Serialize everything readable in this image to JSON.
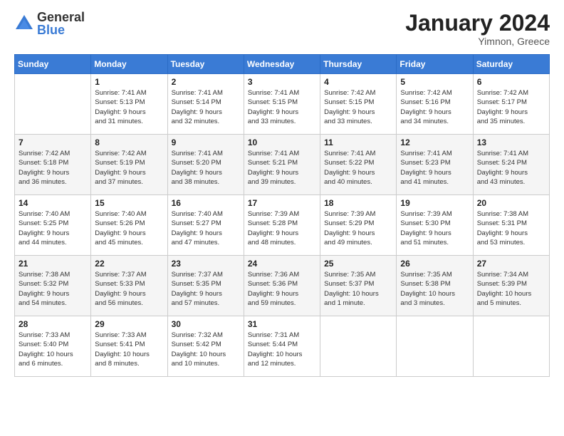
{
  "header": {
    "logo_general": "General",
    "logo_blue": "Blue",
    "month_title": "January 2024",
    "location": "Yimnon, Greece"
  },
  "days_of_week": [
    "Sunday",
    "Monday",
    "Tuesday",
    "Wednesday",
    "Thursday",
    "Friday",
    "Saturday"
  ],
  "weeks": [
    [
      {
        "day": "",
        "info": ""
      },
      {
        "day": "1",
        "info": "Sunrise: 7:41 AM\nSunset: 5:13 PM\nDaylight: 9 hours\nand 31 minutes."
      },
      {
        "day": "2",
        "info": "Sunrise: 7:41 AM\nSunset: 5:14 PM\nDaylight: 9 hours\nand 32 minutes."
      },
      {
        "day": "3",
        "info": "Sunrise: 7:41 AM\nSunset: 5:15 PM\nDaylight: 9 hours\nand 33 minutes."
      },
      {
        "day": "4",
        "info": "Sunrise: 7:42 AM\nSunset: 5:15 PM\nDaylight: 9 hours\nand 33 minutes."
      },
      {
        "day": "5",
        "info": "Sunrise: 7:42 AM\nSunset: 5:16 PM\nDaylight: 9 hours\nand 34 minutes."
      },
      {
        "day": "6",
        "info": "Sunrise: 7:42 AM\nSunset: 5:17 PM\nDaylight: 9 hours\nand 35 minutes."
      }
    ],
    [
      {
        "day": "7",
        "info": "Sunrise: 7:42 AM\nSunset: 5:18 PM\nDaylight: 9 hours\nand 36 minutes."
      },
      {
        "day": "8",
        "info": "Sunrise: 7:42 AM\nSunset: 5:19 PM\nDaylight: 9 hours\nand 37 minutes."
      },
      {
        "day": "9",
        "info": "Sunrise: 7:41 AM\nSunset: 5:20 PM\nDaylight: 9 hours\nand 38 minutes."
      },
      {
        "day": "10",
        "info": "Sunrise: 7:41 AM\nSunset: 5:21 PM\nDaylight: 9 hours\nand 39 minutes."
      },
      {
        "day": "11",
        "info": "Sunrise: 7:41 AM\nSunset: 5:22 PM\nDaylight: 9 hours\nand 40 minutes."
      },
      {
        "day": "12",
        "info": "Sunrise: 7:41 AM\nSunset: 5:23 PM\nDaylight: 9 hours\nand 41 minutes."
      },
      {
        "day": "13",
        "info": "Sunrise: 7:41 AM\nSunset: 5:24 PM\nDaylight: 9 hours\nand 43 minutes."
      }
    ],
    [
      {
        "day": "14",
        "info": "Sunrise: 7:40 AM\nSunset: 5:25 PM\nDaylight: 9 hours\nand 44 minutes."
      },
      {
        "day": "15",
        "info": "Sunrise: 7:40 AM\nSunset: 5:26 PM\nDaylight: 9 hours\nand 45 minutes."
      },
      {
        "day": "16",
        "info": "Sunrise: 7:40 AM\nSunset: 5:27 PM\nDaylight: 9 hours\nand 47 minutes."
      },
      {
        "day": "17",
        "info": "Sunrise: 7:39 AM\nSunset: 5:28 PM\nDaylight: 9 hours\nand 48 minutes."
      },
      {
        "day": "18",
        "info": "Sunrise: 7:39 AM\nSunset: 5:29 PM\nDaylight: 9 hours\nand 49 minutes."
      },
      {
        "day": "19",
        "info": "Sunrise: 7:39 AM\nSunset: 5:30 PM\nDaylight: 9 hours\nand 51 minutes."
      },
      {
        "day": "20",
        "info": "Sunrise: 7:38 AM\nSunset: 5:31 PM\nDaylight: 9 hours\nand 53 minutes."
      }
    ],
    [
      {
        "day": "21",
        "info": "Sunrise: 7:38 AM\nSunset: 5:32 PM\nDaylight: 9 hours\nand 54 minutes."
      },
      {
        "day": "22",
        "info": "Sunrise: 7:37 AM\nSunset: 5:33 PM\nDaylight: 9 hours\nand 56 minutes."
      },
      {
        "day": "23",
        "info": "Sunrise: 7:37 AM\nSunset: 5:35 PM\nDaylight: 9 hours\nand 57 minutes."
      },
      {
        "day": "24",
        "info": "Sunrise: 7:36 AM\nSunset: 5:36 PM\nDaylight: 9 hours\nand 59 minutes."
      },
      {
        "day": "25",
        "info": "Sunrise: 7:35 AM\nSunset: 5:37 PM\nDaylight: 10 hours\nand 1 minute."
      },
      {
        "day": "26",
        "info": "Sunrise: 7:35 AM\nSunset: 5:38 PM\nDaylight: 10 hours\nand 3 minutes."
      },
      {
        "day": "27",
        "info": "Sunrise: 7:34 AM\nSunset: 5:39 PM\nDaylight: 10 hours\nand 5 minutes."
      }
    ],
    [
      {
        "day": "28",
        "info": "Sunrise: 7:33 AM\nSunset: 5:40 PM\nDaylight: 10 hours\nand 6 minutes."
      },
      {
        "day": "29",
        "info": "Sunrise: 7:33 AM\nSunset: 5:41 PM\nDaylight: 10 hours\nand 8 minutes."
      },
      {
        "day": "30",
        "info": "Sunrise: 7:32 AM\nSunset: 5:42 PM\nDaylight: 10 hours\nand 10 minutes."
      },
      {
        "day": "31",
        "info": "Sunrise: 7:31 AM\nSunset: 5:44 PM\nDaylight: 10 hours\nand 12 minutes."
      },
      {
        "day": "",
        "info": ""
      },
      {
        "day": "",
        "info": ""
      },
      {
        "day": "",
        "info": ""
      }
    ]
  ]
}
